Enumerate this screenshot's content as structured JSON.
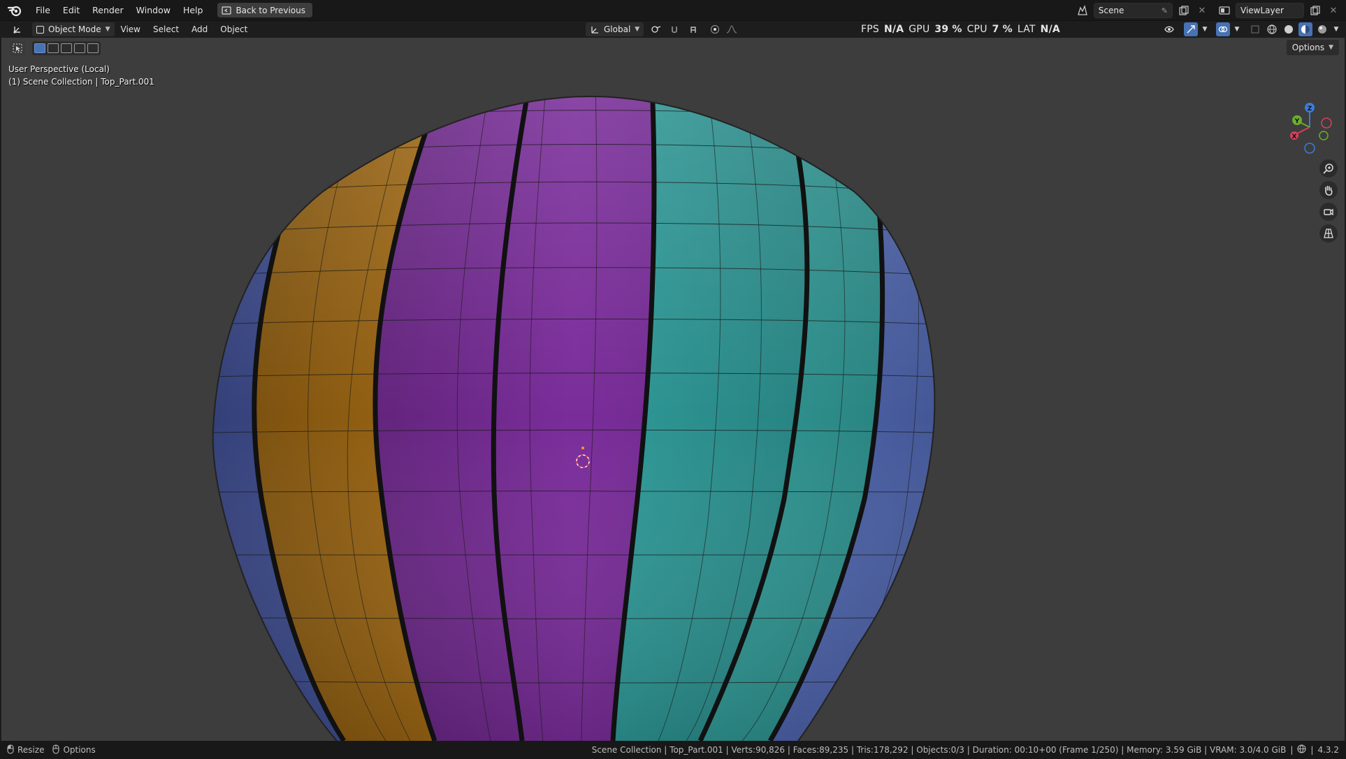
{
  "menubar": {
    "items": [
      "File",
      "Edit",
      "Render",
      "Window",
      "Help"
    ],
    "back_button": "Back to Previous",
    "scene_name": "Scene",
    "view_layer": "ViewLayer"
  },
  "viewport_header": {
    "mode": "Object Mode",
    "menus": [
      "View",
      "Select",
      "Add",
      "Object"
    ],
    "transform_orientation": "Global",
    "stats": {
      "fps_label": "FPS",
      "fps_value": "N/A",
      "gpu_label": "GPU",
      "gpu_value": "39 %",
      "cpu_label": "CPU",
      "cpu_value": "7 %",
      "lat_label": "LAT",
      "lat_value": "N/A"
    },
    "options": "Options"
  },
  "viewport": {
    "perspective": "User Perspective (Local)",
    "collection": "(1) Scene Collection | Top_Part.001",
    "gizmo_axes": {
      "z": "Z",
      "y": "Y",
      "x": "X"
    },
    "panel_colors": {
      "blue": "#4f62b8",
      "orange": "#b47616",
      "purple": "#7a2d9a",
      "teal": "#2f9c9a"
    }
  },
  "statusbar": {
    "hint_resize": "Resize",
    "hint_options": "Options",
    "stats": "Scene Collection | Top_Part.001 | Verts:90,826 | Faces:89,235 | Tris:178,292 | Objects:0/3 | Duration: 00:10+00 (Frame 1/250) | Memory: 3.59 GiB | VRAM: 3.0/4.0 GiB",
    "version": "4.3.2"
  }
}
